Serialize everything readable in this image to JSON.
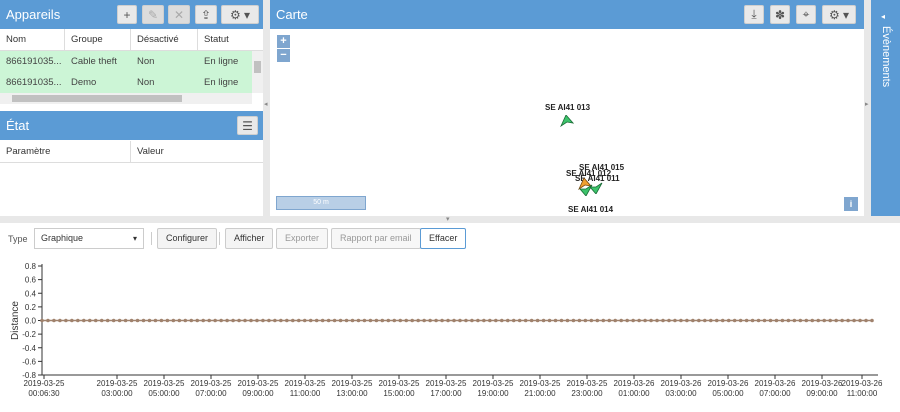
{
  "devices": {
    "title": "Appareils",
    "columns": [
      "Nom",
      "Groupe",
      "Désactivé",
      "Statut"
    ],
    "rows": [
      [
        "866191035...",
        "Cable theft",
        "Non",
        "En ligne"
      ],
      [
        "866191035...",
        "Demo",
        "Non",
        "En ligne"
      ]
    ]
  },
  "state": {
    "title": "État",
    "columns": [
      "Paramètre",
      "Valeur"
    ]
  },
  "map": {
    "title": "Carte",
    "zoom_in": "+",
    "zoom_out": "−",
    "scale": "50 m",
    "info": "i",
    "vehicles": [
      "SE AI41 013",
      "SE AI41 015",
      "SE AI41 012",
      "SE AI41 011",
      "SE AI41 014"
    ]
  },
  "events": {
    "title": "Évènements"
  },
  "toolbar": {
    "type_label": "Type",
    "type_value": "Graphique",
    "configure": "Configurer",
    "show": "Afficher",
    "export": "Exporter",
    "email": "Rapport par email",
    "clear": "Effacer"
  },
  "chart_data": {
    "type": "line",
    "ylabel": "Distance",
    "ylim": [
      -0.8,
      0.8
    ],
    "yticks": [
      "0.8",
      "0.6",
      "0.4",
      "0.2",
      "0.0",
      "-0.2",
      "-0.4",
      "-0.6",
      "-0.8"
    ],
    "x_ticks": [
      [
        "2019-03-25",
        "00:06:30"
      ],
      [
        "2019-03-25",
        "03:00:00"
      ],
      [
        "2019-03-25",
        "05:00:00"
      ],
      [
        "2019-03-25",
        "07:00:00"
      ],
      [
        "2019-03-25",
        "09:00:00"
      ],
      [
        "2019-03-25",
        "11:00:00"
      ],
      [
        "2019-03-25",
        "13:00:00"
      ],
      [
        "2019-03-25",
        "15:00:00"
      ],
      [
        "2019-03-25",
        "17:00:00"
      ],
      [
        "2019-03-25",
        "19:00:00"
      ],
      [
        "2019-03-25",
        "21:00:00"
      ],
      [
        "2019-03-25",
        "23:00:00"
      ],
      [
        "2019-03-26",
        "01:00:00"
      ],
      [
        "2019-03-26",
        "03:00:00"
      ],
      [
        "2019-03-26",
        "05:00:00"
      ],
      [
        "2019-03-26",
        "07:00:00"
      ],
      [
        "2019-03-26",
        "09:00:00"
      ],
      [
        "2019-03-26",
        "11:00:00"
      ]
    ],
    "series": [
      {
        "values_constant": 0,
        "point_count": 140,
        "color": "#a0826d"
      }
    ]
  }
}
